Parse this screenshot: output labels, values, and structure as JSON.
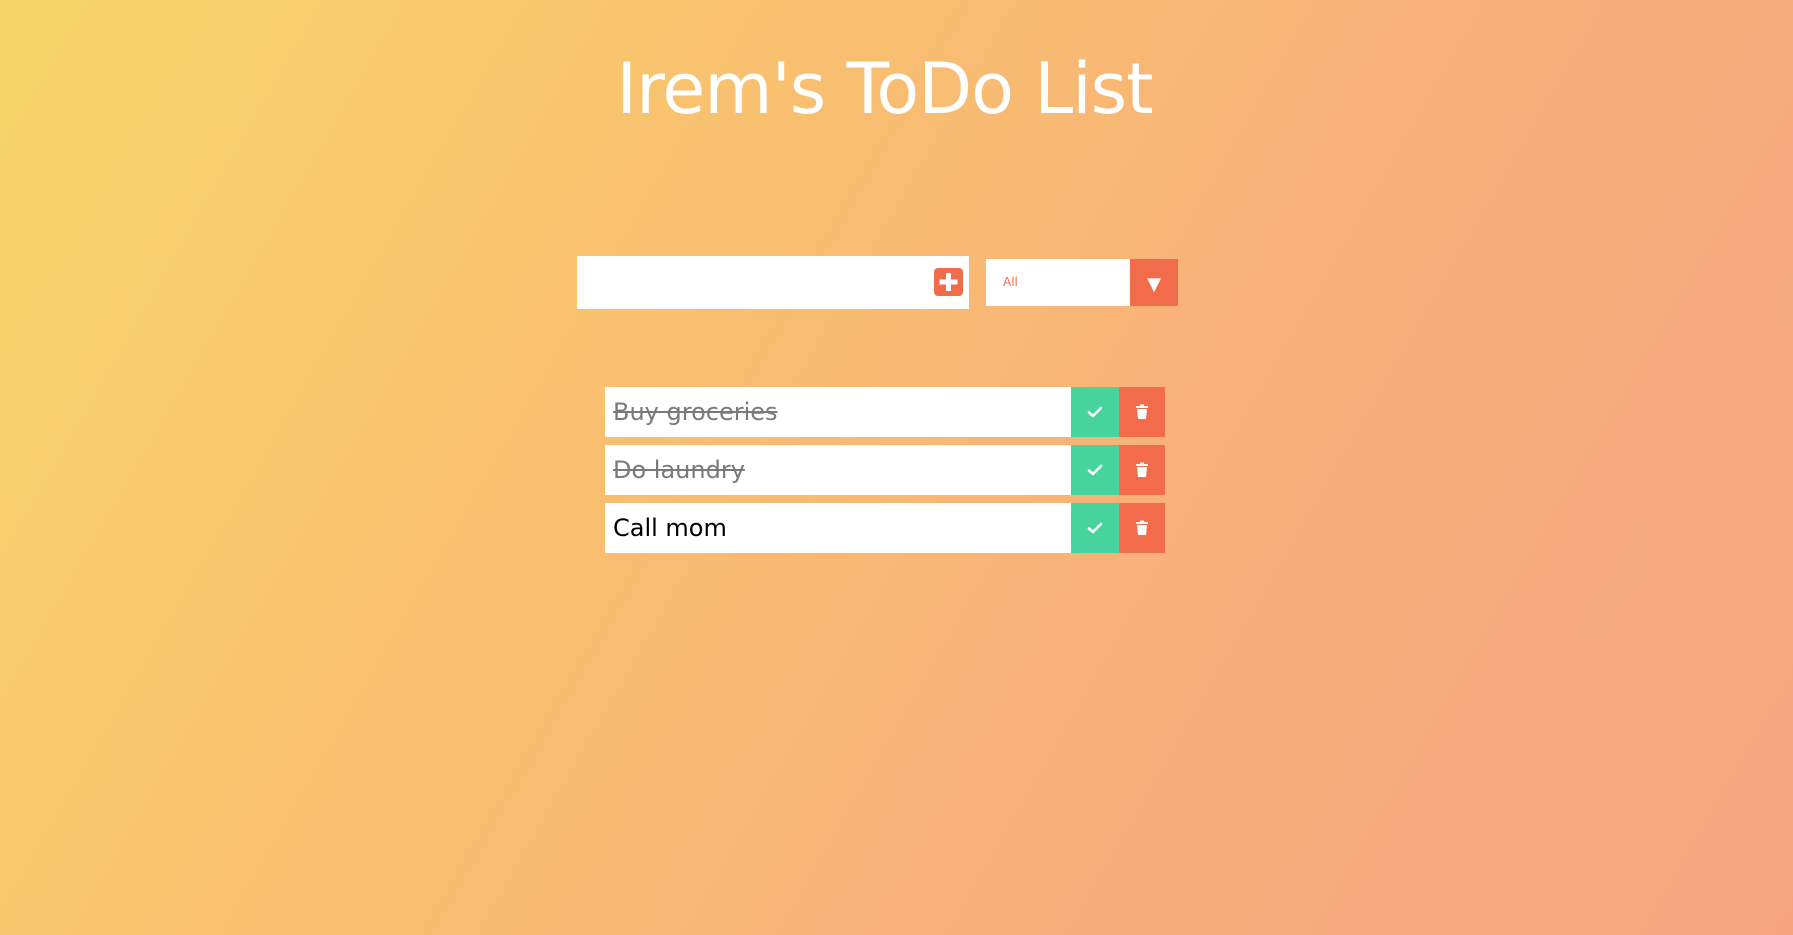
{
  "app": {
    "title": "Irem's ToDo List"
  },
  "form": {
    "input_value": "",
    "input_placeholder": "",
    "add_icon": "plus-square-icon"
  },
  "filter": {
    "selected": "All",
    "arrow_glyph": "▼"
  },
  "todos": [
    {
      "text": "Buy groceries",
      "completed": true
    },
    {
      "text": "Do laundry",
      "completed": true
    },
    {
      "text": "Call mom",
      "completed": false
    }
  ],
  "item_icons": {
    "complete": "check-icon",
    "delete": "trash-icon"
  },
  "colors": {
    "accent": "#f26c4c",
    "complete": "#47d39e",
    "gradient_start": "#f8d568",
    "gradient_end": "#f7a382",
    "completed_text": "#7a7a7a"
  }
}
